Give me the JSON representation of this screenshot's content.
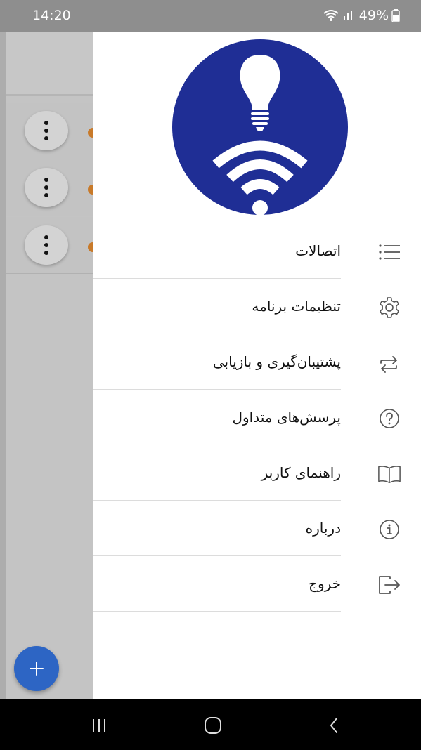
{
  "status_bar": {
    "time": "14:20",
    "battery": "49%",
    "icons": [
      "wifi-icon",
      "signal-icon",
      "battery-icon"
    ]
  },
  "background_screen": {
    "rows": [
      {
        "icon": "more-vert-icon"
      },
      {
        "icon": "more-vert-icon"
      },
      {
        "icon": "more-vert-icon"
      }
    ],
    "fab_icon": "plus-icon"
  },
  "drawer": {
    "logo_icon": "lightbulb-wifi-logo",
    "colors": {
      "logo_bg": "#1f2e95",
      "fab": "#2d65c4",
      "status_dot": "#c87a2a"
    },
    "items": [
      {
        "label": "اتصالات",
        "icon": "list-icon"
      },
      {
        "label": "تنظیمات برنامه",
        "icon": "gear-icon"
      },
      {
        "label": "پشتیبان‌گیری و بازیابی",
        "icon": "sync-arrows-icon"
      },
      {
        "label": "پرسش‌های متداول",
        "icon": "question-circle-icon"
      },
      {
        "label": "راهنمای کاربر",
        "icon": "book-icon"
      },
      {
        "label": "درباره",
        "icon": "info-circle-icon"
      },
      {
        "label": "خروج",
        "icon": "logout-icon"
      }
    ]
  },
  "nav_bar": {
    "buttons": [
      "recents-icon",
      "home-icon",
      "back-icon"
    ]
  }
}
